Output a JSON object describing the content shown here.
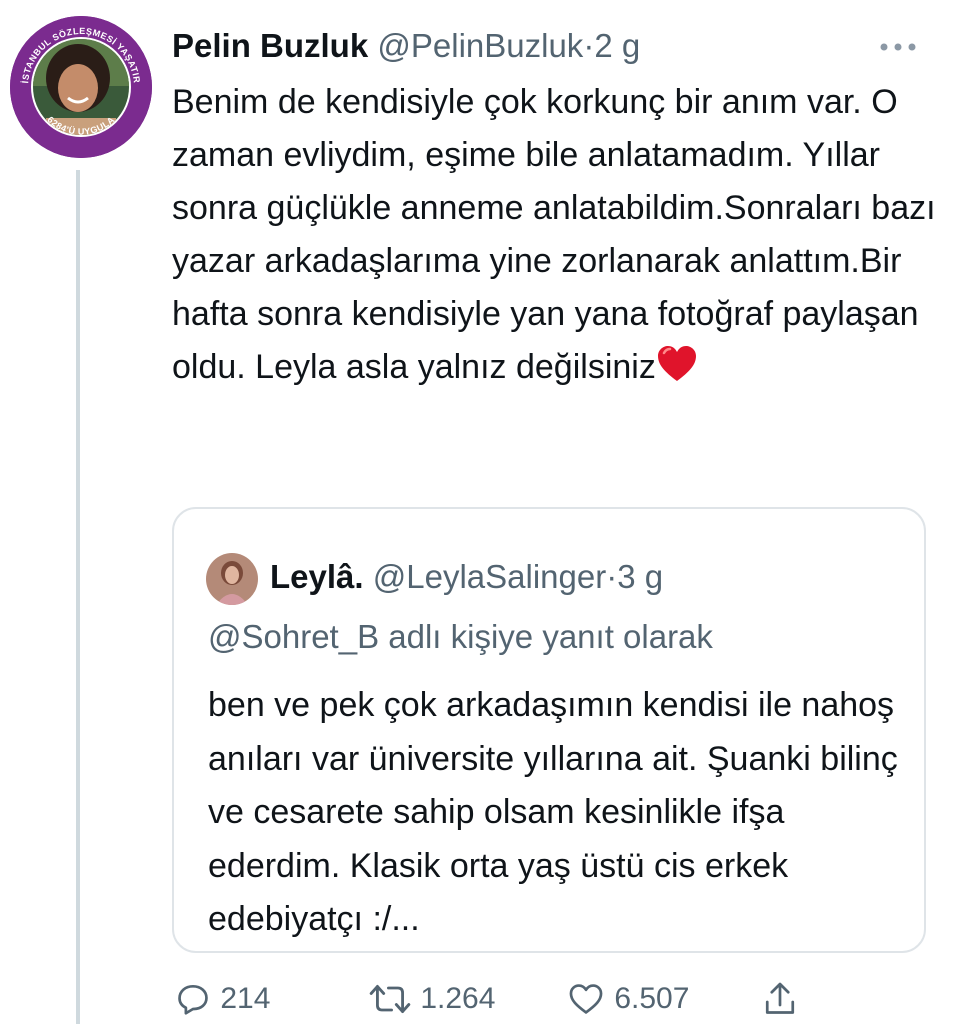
{
  "tweet": {
    "author_name": "Pelin Buzluk",
    "handle": "@PelinBuzluk",
    "separator": "·",
    "time": "2 g",
    "more_icon": "more-horizontal-icon",
    "avatar_badge_top": "İSTANBUL SÖZLEŞMESİ YAŞATIR",
    "avatar_badge_bottom": "6284'Ü UYGULA",
    "text": "Benim de kendisiyle çok korkunç bir anım var. O zaman evliydim, eşime bile anlatamadım. Yıllar sonra güçlükle anneme anlatabildim.Sonraları bazı yazar arkadaşlarıma yine zorlanarak anlattım.Bir hafta sonra kendisiyle yan yana fotoğraf paylaşan oldu. Leyla asla yalnız değilsiniz",
    "text_emoji": "red-heart-icon"
  },
  "quoted_tweet": {
    "author_name": "Leylâ.",
    "handle": "@LeylaSalinger",
    "separator": "·",
    "time": "3 g",
    "reply_to": "@Sohret_B adlı kişiye yanıt olarak",
    "text": "ben ve pek çok arkadaşımın kendisi ile nahoş anıları var üniversite yıllarına ait. Şuanki bilinç ve cesarete sahip olsam kesinlikle ifşa ederdim.  Klasik orta yaş üstü cis erkek edebiyatçı :/..."
  },
  "actions": {
    "replies": "214",
    "retweets": "1.264",
    "likes": "6.507"
  },
  "colors": {
    "text": "#0f1419",
    "secondary": "#536471",
    "badge_purple": "#7b2b8f",
    "border": "#dfe4e8",
    "heart": "#e0245e"
  }
}
